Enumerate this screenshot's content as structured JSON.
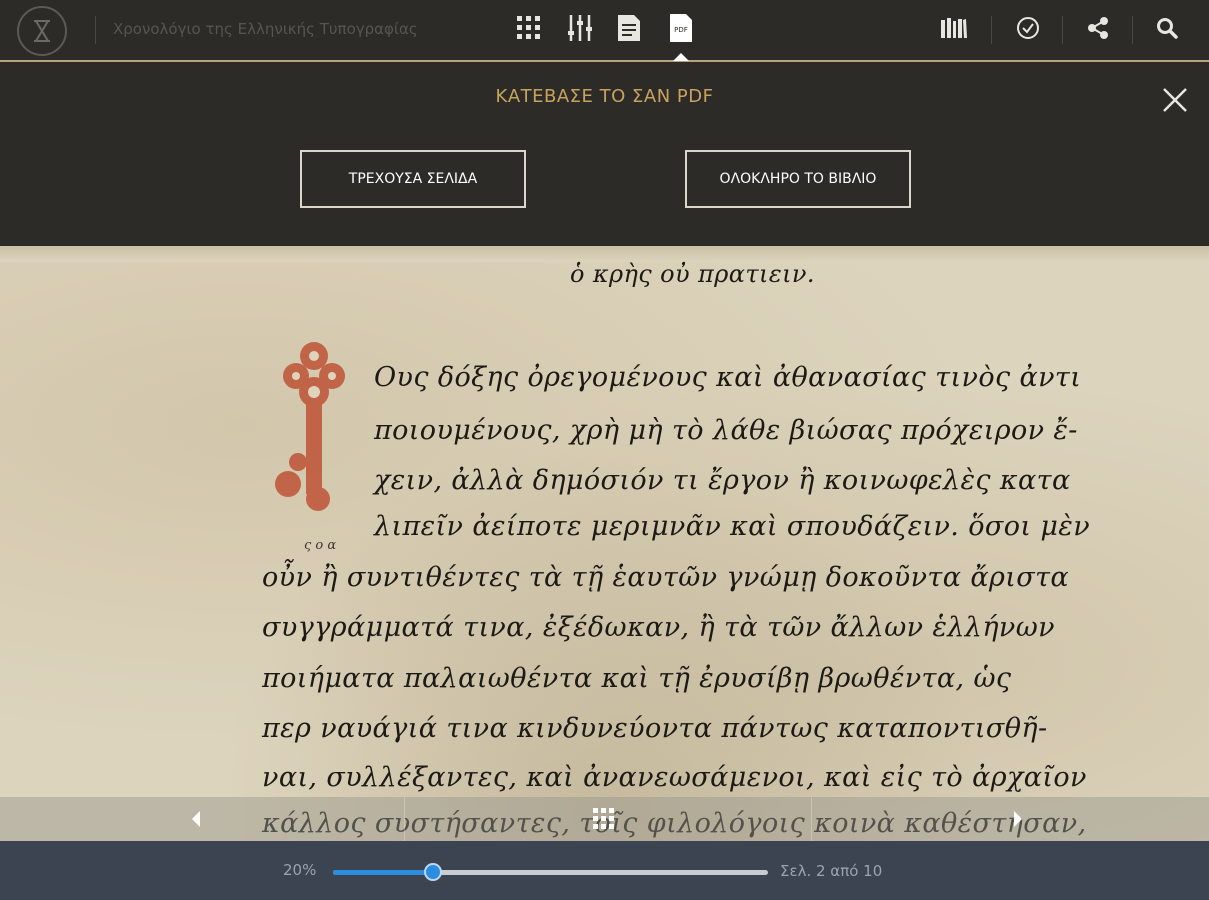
{
  "header": {
    "app_title": "Χρονολόγιο της Ελληνικής Τυπογραφίας",
    "icons": [
      "logo-hourglass-icon",
      "grid-icon",
      "sliders-icon",
      "document-icon",
      "pdf-icon",
      "library-icon",
      "check-circle-icon",
      "share-icon",
      "search-icon"
    ],
    "pdf_icon_label": "PDF"
  },
  "pdf_panel": {
    "title": "ΚΑΤΕΒΑΣΕ ΤΟ ΣΑΝ PDF",
    "current_page_button": "ΤΡΕΧΟΥΣΑ ΣΕΛΙΔΑ",
    "whole_book_button": "ΟΛΟΚΛΗΡΟ ΤΟ ΒΙΒΛΙΟ"
  },
  "manuscript": {
    "heading_line": "ὁ κρὴς οὐ πρατιειν.",
    "lines": [
      "Ους δόξης ὀρεγομένους καὶ ἀθανασίας τινὸς ἀντι",
      "ποιουμένους, χρὴ μὴ τὸ λάθε βιώσας πρόχειρον ἔ-",
      "χειν, ἀλλὰ δημόσιόν τι ἔργον ἢ κοινωφελὲς κατα",
      "λιπεῖν ἀείποτε μεριμνᾶν καὶ σπουδάζειν. ὅσοι μὲν",
      "οὖν ἢ συντιθέντες τὰ τῇ ἑαυτῶν γνώμῃ δοκοῦντα ἄριστα",
      "συγγράμματά τινα, ἐξέδωκαν, ἢ τὰ τῶν ἄλλων ἑλλήνων",
      "ποιήματα παλαιωθέντα καὶ τῇ ἐρυσίβῃ βρωθέντα, ὡς",
      "περ ναυάγιά τινα κινδυνεύοντα πάντως καταποντισθῆ-",
      "ναι, συλλέξαντες, καὶ ἀνανεωσάμενοι, καὶ εἰς τὸ ἀρχαῖον",
      "κάλλος συστήσαντες, τοῖς φιλολόγοις κοινὰ καθέστησαν,"
    ],
    "margin_note": "ς ο α"
  },
  "footer": {
    "zoom": "20%",
    "page_indicator": "Σελ. 2 από 10",
    "progress_fraction": 0.23
  },
  "colors": {
    "accent_gold": "#c9a35d",
    "slider_blue": "#2b8de0",
    "topbar_bg": "#2c2b27",
    "footer_bg": "#3b4450"
  }
}
